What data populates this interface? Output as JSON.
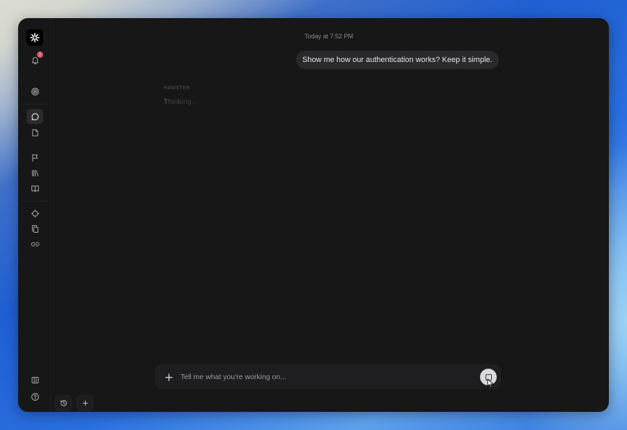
{
  "sidebar": {
    "notification_count": "1",
    "items": [
      {
        "icon": "target-icon"
      },
      {
        "icon": "chat-icon",
        "active": true
      },
      {
        "icon": "document-icon"
      },
      {
        "icon": "flag-icon"
      },
      {
        "icon": "library-icon"
      },
      {
        "icon": "book-icon"
      },
      {
        "icon": "crosshair-icon"
      },
      {
        "icon": "copy-icon"
      },
      {
        "icon": "link-icon"
      },
      {
        "icon": "panel-icon"
      },
      {
        "icon": "help-icon"
      }
    ]
  },
  "chat": {
    "timestamp": "Today at 7:52 PM",
    "user_message": "Show me how our authentication works? Keep it simple.",
    "agent_name": "HAMSTER",
    "agent_status": "Thinking..."
  },
  "composer": {
    "placeholder": "Tell me what you're working on..."
  },
  "colors": {
    "app_background": "#171718",
    "bubble": "#2a2a2c",
    "badge": "#e0555f"
  }
}
